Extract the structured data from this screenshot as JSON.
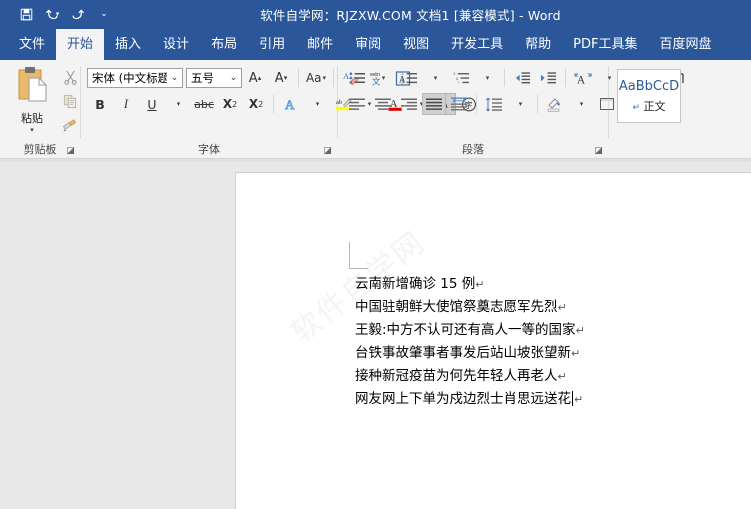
{
  "titlebar": {
    "title": "软件自学网：RJZXW.COM  文档1 [兼容模式]  -  Word",
    "quick_access": [
      {
        "name": "save-button",
        "icon": "save-icon",
        "label": "保存"
      },
      {
        "name": "undo-button",
        "icon": "undo-icon",
        "label": "撤消"
      },
      {
        "name": "redo-button",
        "icon": "redo-icon",
        "label": "恢复"
      },
      {
        "name": "customize-qat-button",
        "icon": "chevron-down-icon",
        "label": "自定义快速访问工具栏"
      }
    ],
    "background": "#2b579a"
  },
  "tabs": [
    {
      "label": "文件",
      "active": false
    },
    {
      "label": "开始",
      "active": true
    },
    {
      "label": "插入",
      "active": false
    },
    {
      "label": "设计",
      "active": false
    },
    {
      "label": "布局",
      "active": false
    },
    {
      "label": "引用",
      "active": false
    },
    {
      "label": "邮件",
      "active": false
    },
    {
      "label": "审阅",
      "active": false
    },
    {
      "label": "视图",
      "active": false
    },
    {
      "label": "开发工具",
      "active": false
    },
    {
      "label": "帮助",
      "active": false
    },
    {
      "label": "PDF工具集",
      "active": false
    },
    {
      "label": "百度网盘",
      "active": false
    }
  ],
  "ribbon": {
    "clipboard": {
      "group_label": "剪贴板",
      "paste_label": "粘贴",
      "paste_icon": "clipboard-icon",
      "cut_label": "剪切",
      "copy_label": "复制",
      "format_painter_label": "格式刷",
      "launcher_label": "剪贴板对话框启动器"
    },
    "font": {
      "group_label": "字体",
      "font_name": "宋体 (中文标题",
      "font_size": "五号",
      "grow_font": "A",
      "shrink_font": "A",
      "change_case": "Aa",
      "clear_formatting_label": "清除所有格式",
      "phonetic_guide_label": "拼音指南",
      "char_border_label": "字符边框",
      "bold": "B",
      "italic": "I",
      "underline": "U",
      "strikethrough": "abc",
      "subscript": "X",
      "superscript": "X",
      "text_effects_label": "文本效果和版式",
      "highlight_label": "文本突出显示颜色",
      "font_color_label": "字体颜色",
      "char_shading_label": "字符底纹",
      "enclose_char_label": "带圈字符",
      "launcher_label": "字体对话框启动器"
    },
    "paragraph": {
      "group_label": "段落",
      "bullets_label": "项目符号",
      "numbering_label": "编号",
      "multilevel_label": "多级列表",
      "decrease_indent_label": "减少缩进量",
      "increase_indent_label": "增加缩进量",
      "chinese_layout_label": "中文版式",
      "sort_label": "排序",
      "show_marks_label": "显示编辑标记",
      "align_left_label": "左对齐",
      "align_center_label": "居中",
      "align_right_label": "右对齐",
      "justify_label": "两端对齐",
      "justify_active": true,
      "distribute_label": "分散对齐",
      "line_spacing_label": "行和段落间距",
      "shading_label": "底纹",
      "borders_label": "边框",
      "launcher_label": "段落对话框启动器"
    },
    "styles": {
      "preview_text": "AaBbCcD",
      "style_name": "正文",
      "pilcrow": "↵"
    }
  },
  "document": {
    "watermark": "软件自学网",
    "lines": [
      {
        "text": "云南新增确诊 15 例",
        "mark": "↵",
        "cursor": false
      },
      {
        "text": "中国驻朝鲜大使馆祭奠志愿军先烈",
        "mark": "↵",
        "cursor": false
      },
      {
        "text": "王毅:中方不认可还有高人一等的国家",
        "mark": "↵",
        "cursor": false
      },
      {
        "text": "台铁事故肇事者事发后站山坡张望新",
        "mark": "↵",
        "cursor": false
      },
      {
        "text": "接种新冠疫苗为何先年轻人再老人",
        "mark": "↵",
        "cursor": false
      },
      {
        "text": "网友网上下单为戍边烈士肖思远送花",
        "mark": "↵",
        "cursor": true
      }
    ]
  }
}
